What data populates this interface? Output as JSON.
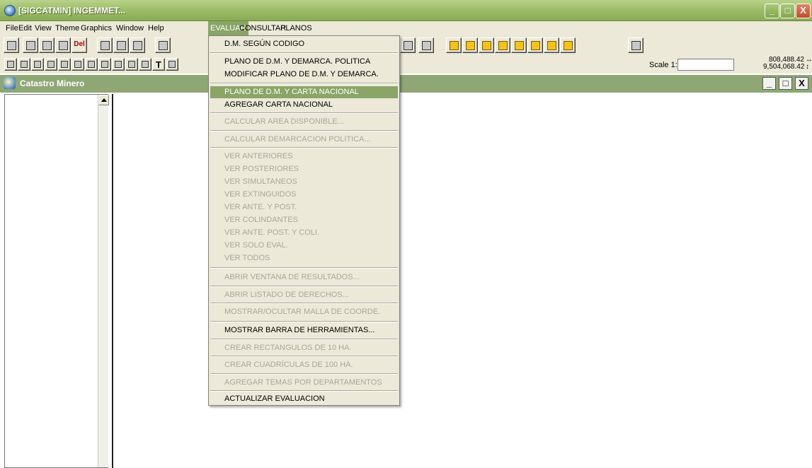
{
  "window": {
    "title": "[SIGCATMIN] INGEMMET...",
    "minimize": "_",
    "maximize": "□",
    "close": "X"
  },
  "menubar": {
    "items": [
      "File",
      "Edit",
      "View",
      "Theme",
      "Graphics",
      "Window",
      "Help",
      "EVALUAR",
      "CONSULTAR",
      "PLANOS"
    ],
    "active": "EVALUAR"
  },
  "toolbar": {
    "del_label": "Del",
    "text_tool_label": "T",
    "scale_label": "Scale 1:",
    "scale_value": "",
    "coord_x": "808,488.42",
    "coord_y": "9,504,068.42"
  },
  "child_window": {
    "title": "Catastro Minero",
    "minimize": "_",
    "restore": "□",
    "close": "X"
  },
  "evaluar_menu": [
    {
      "label": "D.M. SEGÚN CODIGO",
      "state": "enabled"
    },
    {
      "label": "PLANO DE D.M. Y DEMARCA. POLITICA",
      "state": "enabled"
    },
    {
      "label": "MODIFICAR PLANO DE D.M. Y DEMARCA.",
      "state": "enabled"
    },
    {
      "label": "PLANO DE D.M. Y CARTA NACIONAL",
      "state": "selected"
    },
    {
      "label": "AGREGAR CARTA NACIONAL",
      "state": "enabled"
    },
    {
      "label": "CALCULAR AREA DISPONIBLE...",
      "state": "disabled"
    },
    {
      "label": "CALCULAR DEMARCACION POLITICA...",
      "state": "disabled"
    },
    {
      "label": "VER ANTERIORES",
      "state": "disabled"
    },
    {
      "label": "VER POSTERIORES",
      "state": "disabled"
    },
    {
      "label": "VER SIMULTANEOS",
      "state": "disabled"
    },
    {
      "label": "VER EXTINGUIDOS",
      "state": "disabled"
    },
    {
      "label": "VER ANTE. Y POST.",
      "state": "disabled"
    },
    {
      "label": "VER COLINDANTES",
      "state": "disabled"
    },
    {
      "label": "VER ANTE. POST. Y COLI.",
      "state": "disabled"
    },
    {
      "label": "VER SOLO EVAL.",
      "state": "disabled"
    },
    {
      "label": "VER TODOS",
      "state": "disabled"
    },
    {
      "label": "ABRIR VENTANA DE RESULTADOS...",
      "state": "disabled"
    },
    {
      "label": "ABRIR LISTADO DE DERECHOS...",
      "state": "disabled"
    },
    {
      "label": "MOSTRAR/OCULTAR MALLA DE COORDE.",
      "state": "disabled"
    },
    {
      "label": "MOSTRAR BARRA DE HERRAMIENTAS...",
      "state": "enabled"
    },
    {
      "label": "CREAR RECTANGULOS DE 10 HA.",
      "state": "disabled"
    },
    {
      "label": "CREAR CUADRÍCULAS DE 100 HA.",
      "state": "disabled"
    },
    {
      "label": "AGREGAR TEMAS POR DEPARTAMENTOS",
      "state": "disabled"
    },
    {
      "label": "ACTUALIZAR EVALUACION",
      "state": "enabled"
    }
  ],
  "colors": {
    "title_bar": "#9fbe6a",
    "menu_highlight": "#8aa567",
    "child_title_bar": "#8fa775",
    "menu_background": "#ece9d8",
    "disabled_text": "#a8a79b"
  }
}
